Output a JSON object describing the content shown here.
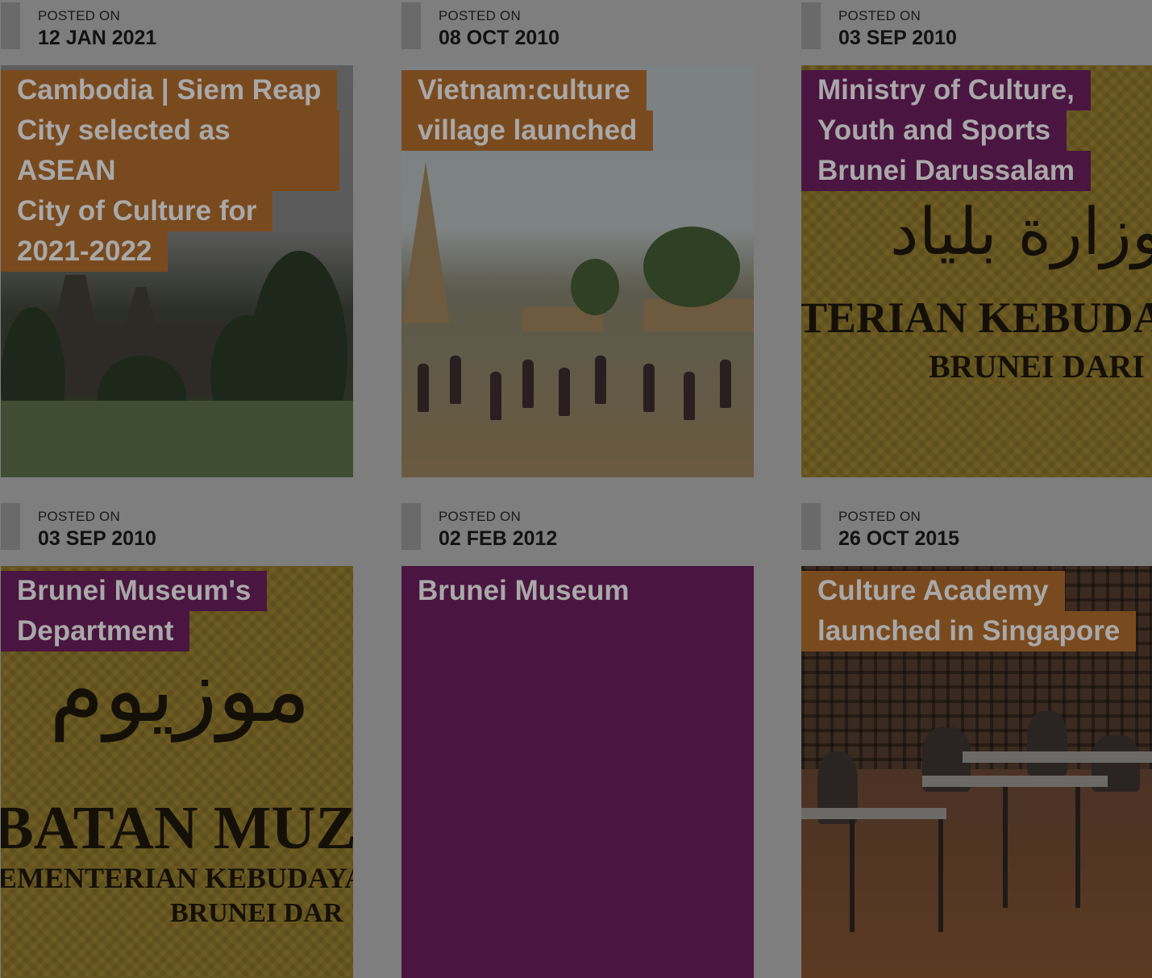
{
  "posted_label": "POSTED ON",
  "cards": [
    {
      "date": "12 JAN 2021",
      "title_lines": [
        "Cambodia | Siem Reap",
        "City selected as ASEAN",
        "City of Culture for",
        "2021-2022"
      ],
      "label_color": "#7a4a1f"
    },
    {
      "date": "08 OCT 2010",
      "title_lines": [
        "Vietnam:culture",
        "village launched"
      ],
      "label_color": "#7a4a1f"
    },
    {
      "date": "03 SEP 2010",
      "title_lines": [
        "Ministry of Culture,",
        "Youth and Sports",
        "Brunei Darussalam"
      ],
      "label_color": "#4a1540",
      "emblem_text": [
        "TERIAN KEBUDAYA",
        "BRUNEI DARI"
      ]
    },
    {
      "date": "03 SEP 2010",
      "title_lines": [
        "Brunei Museum's",
        "Department"
      ],
      "label_color": "#4a1540",
      "emblem_text": [
        "BATAN MUZI",
        "EMENTERIAN KEBUDAYA",
        "BRUNEI DAR"
      ]
    },
    {
      "date": "02 FEB 2012",
      "title_lines": [
        "Brunei Museum"
      ],
      "label_color": "#4a1540"
    },
    {
      "date": "26 OCT 2015",
      "title_lines": [
        "Culture Academy",
        "launched in Singapore"
      ],
      "label_color": "#7a4a1f"
    }
  ]
}
